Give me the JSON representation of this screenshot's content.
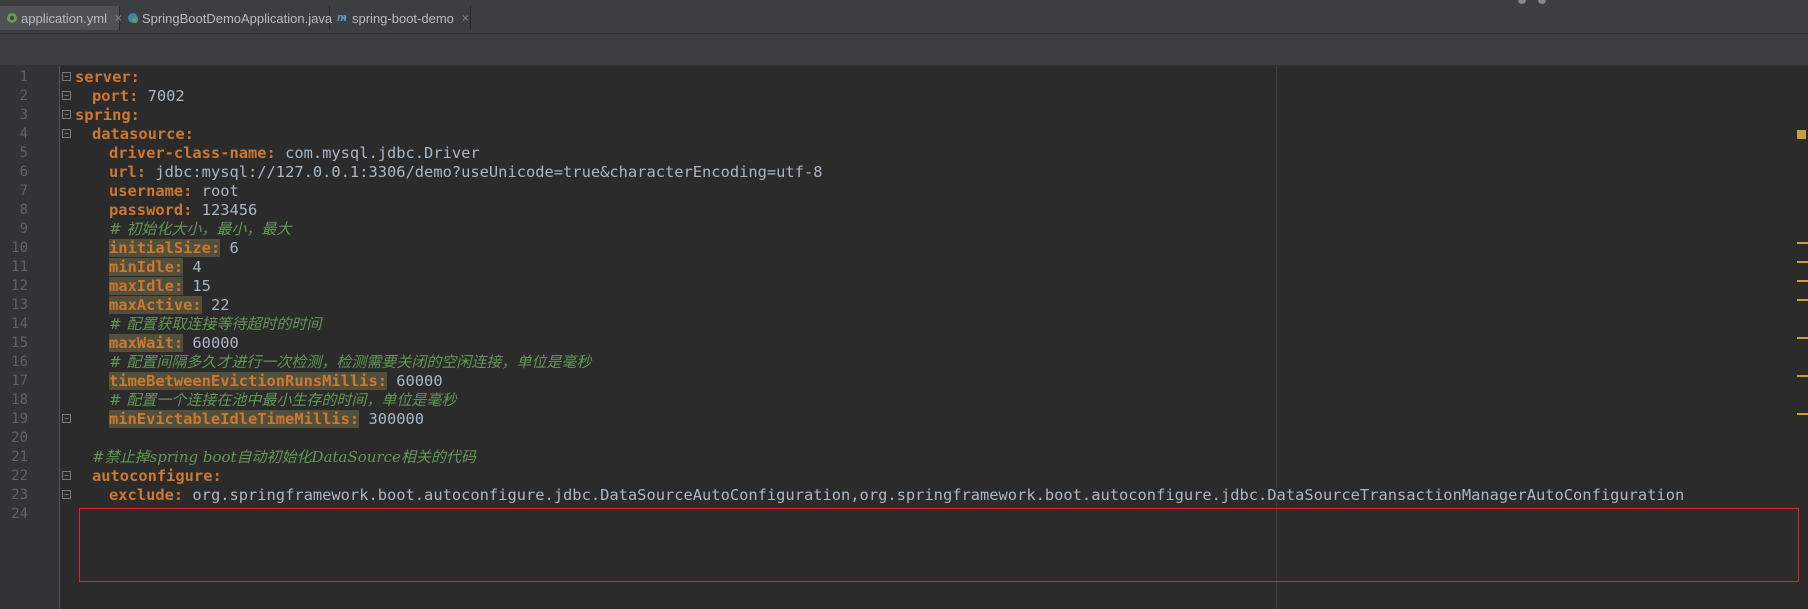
{
  "tabs": [
    {
      "label": "application.yml",
      "icon": "yml-leaf-icon",
      "active": true
    },
    {
      "label": "SpringBootDemoApplication.java",
      "icon": "java-class-icon",
      "active": false
    },
    {
      "label": "spring-boot-demo",
      "icon": "maven-icon",
      "active": false
    }
  ],
  "editor": {
    "lines": [
      {
        "n": "1",
        "key": "server:",
        "val": ""
      },
      {
        "n": "2",
        "key": "port:",
        "val": " 7002"
      },
      {
        "n": "3",
        "key": "spring:",
        "val": ""
      },
      {
        "n": "4",
        "key": "datasource:",
        "val": ""
      },
      {
        "n": "5",
        "key": "driver-class-name:",
        "val": " com.mysql.jdbc.Driver"
      },
      {
        "n": "6",
        "key": "url:",
        "val": " jdbc:mysql://127.0.0.1:3306/demo?useUnicode=true&characterEncoding=utf-8"
      },
      {
        "n": "7",
        "key": "username:",
        "val": " root"
      },
      {
        "n": "8",
        "key": "password:",
        "val": " 123456"
      },
      {
        "n": "9",
        "comment": "# 初始化大小，最小，最大"
      },
      {
        "n": "10",
        "key": "initialSize:",
        "val": " 6",
        "hl": true
      },
      {
        "n": "11",
        "key": "minIdle:",
        "val": " 4",
        "hl": true
      },
      {
        "n": "12",
        "key": "maxIdle:",
        "val": " 15",
        "hl": true
      },
      {
        "n": "13",
        "key": "maxActive:",
        "val": " 22",
        "hl": true
      },
      {
        "n": "14",
        "comment": "# 配置获取连接等待超时的时间"
      },
      {
        "n": "15",
        "key": "maxWait:",
        "val": " 60000",
        "hl": true
      },
      {
        "n": "16",
        "comment": "# 配置间隔多久才进行一次检测，检测需要关闭的空闲连接，单位是毫秒"
      },
      {
        "n": "17",
        "key": "timeBetweenEvictionRunsMillis:",
        "val": " 60000",
        "hl": true
      },
      {
        "n": "18",
        "comment": "# 配置一个连接在池中最小生存的时间，单位是毫秒"
      },
      {
        "n": "19",
        "key": "minEvictableIdleTimeMillis:",
        "val": " 300000",
        "hl": true
      },
      {
        "n": "20",
        "key": "",
        "val": ""
      },
      {
        "n": "21",
        "comment": "#禁止掉spring boot自动初始化DataSource相关的代码"
      },
      {
        "n": "22",
        "key": "autoconfigure:",
        "val": ""
      },
      {
        "n": "23",
        "key": "exclude:",
        "val": " org.springframework.boot.autoconfigure.jdbc.DataSourceAutoConfiguration,org.springframework.boot.autoconfigure.jdbc.DataSourceTransactionManagerAutoConfiguration"
      },
      {
        "n": "24",
        "key": "",
        "val": ""
      }
    ]
  }
}
